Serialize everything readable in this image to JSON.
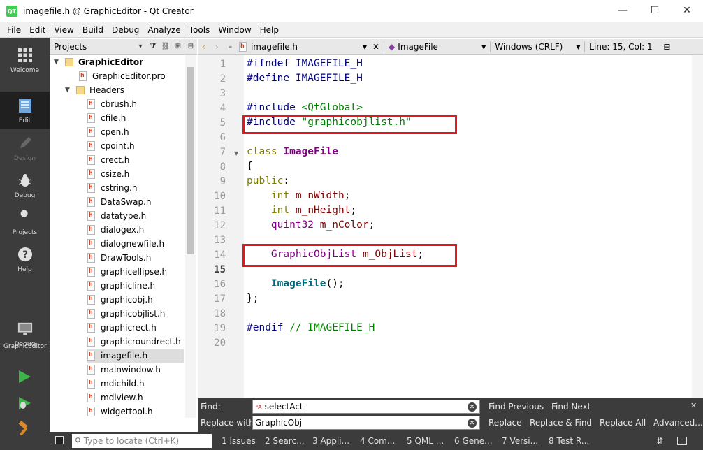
{
  "window": {
    "title": "imagefile.h @ GraphicEditor - Qt Creator",
    "logo_text": "QT",
    "minimize": "—",
    "maximize": "☐",
    "close": "✕"
  },
  "menu": [
    {
      "underline": "F",
      "rest": "ile"
    },
    {
      "underline": "E",
      "rest": "dit"
    },
    {
      "underline": "V",
      "rest": "iew"
    },
    {
      "underline": "B",
      "rest": "uild"
    },
    {
      "underline": "D",
      "rest": "ebug"
    },
    {
      "underline": "A",
      "rest": "nalyze"
    },
    {
      "underline": "T",
      "rest": "ools"
    },
    {
      "underline": "W",
      "rest": "indow"
    },
    {
      "underline": "H",
      "rest": "elp"
    }
  ],
  "modes": {
    "welcome": "Welcome",
    "edit": "Edit",
    "design": "Design",
    "debug": "Debug",
    "projects": "Projects",
    "help": "Help"
  },
  "kit": {
    "project": "GraphicEditor",
    "build": "Debug"
  },
  "project_panel": {
    "title": "Projects",
    "root": "GraphicEditor",
    "pro_file": "GraphicEditor.pro",
    "headers_label": "Headers",
    "files": [
      "cbrush.h",
      "cfile.h",
      "cpen.h",
      "cpoint.h",
      "crect.h",
      "csize.h",
      "cstring.h",
      "DataSwap.h",
      "datatype.h",
      "dialogex.h",
      "dialognewfile.h",
      "DrawTools.h",
      "graphicellipse.h",
      "graphicline.h",
      "graphicobj.h",
      "graphicobjlist.h",
      "graphicrect.h",
      "graphicroundrect.h",
      "imagefile.h",
      "mainwindow.h",
      "mdichild.h",
      "mdiview.h",
      "widgettool.h"
    ],
    "selected_file": "imagefile.h"
  },
  "editor_toolbar": {
    "file": "imagefile.h",
    "symbol": "ImageFile",
    "line_endings": "Windows (CRLF)",
    "position": "Line: 15, Col: 1"
  },
  "editor": {
    "current_line": 15,
    "line_numbers": [
      "1",
      "2",
      "3",
      "4",
      "5",
      "6",
      "7",
      "8",
      "9",
      "10",
      "11",
      "12",
      "13",
      "14",
      "15",
      "16",
      "17",
      "18",
      "19",
      "20"
    ],
    "lines": [
      [
        {
          "t": "#ifndef IMAGEFILE_H",
          "c": "c-pre"
        }
      ],
      [
        {
          "t": "#define IMAGEFILE_H",
          "c": "c-pre"
        }
      ],
      [],
      [
        {
          "t": "#include ",
          "c": "c-pre"
        },
        {
          "t": "<QtGlobal>",
          "c": "c-str"
        }
      ],
      [
        {
          "t": "#include ",
          "c": "c-pre"
        },
        {
          "t": "\"graphicobjlist.h\"",
          "c": "c-str"
        }
      ],
      [],
      [
        {
          "t": "class ",
          "c": "c-kw"
        },
        {
          "t": "ImageFile",
          "c": "c-cls"
        }
      ],
      [
        {
          "t": "{",
          "c": "c-plain"
        }
      ],
      [
        {
          "t": "public",
          "c": "c-kw"
        },
        {
          "t": ":",
          "c": "c-plain"
        }
      ],
      [
        {
          "t": "    ",
          "c": "c-plain"
        },
        {
          "t": "int",
          "c": "c-kw"
        },
        {
          "t": " ",
          "c": "c-plain"
        },
        {
          "t": "m_nWidth",
          "c": "c-mem"
        },
        {
          "t": ";",
          "c": "c-plain"
        }
      ],
      [
        {
          "t": "    ",
          "c": "c-plain"
        },
        {
          "t": "int",
          "c": "c-kw"
        },
        {
          "t": " ",
          "c": "c-plain"
        },
        {
          "t": "m_nHeight",
          "c": "c-mem"
        },
        {
          "t": ";",
          "c": "c-plain"
        }
      ],
      [
        {
          "t": "    ",
          "c": "c-plain"
        },
        {
          "t": "quint32",
          "c": "c-type"
        },
        {
          "t": " ",
          "c": "c-plain"
        },
        {
          "t": "m_nColor",
          "c": "c-mem"
        },
        {
          "t": ";",
          "c": "c-plain"
        }
      ],
      [],
      [
        {
          "t": "    ",
          "c": "c-plain"
        },
        {
          "t": "GraphicObjList",
          "c": "c-type"
        },
        {
          "t": " ",
          "c": "c-plain"
        },
        {
          "t": "m_ObjList",
          "c": "c-mem"
        },
        {
          "t": ";",
          "c": "c-plain"
        }
      ],
      [],
      [
        {
          "t": "    ",
          "c": "c-plain"
        },
        {
          "t": "ImageFile",
          "c": "c-fn"
        },
        {
          "t": "();",
          "c": "c-plain"
        }
      ],
      [
        {
          "t": "};",
          "c": "c-plain"
        }
      ],
      [],
      [
        {
          "t": "#endif ",
          "c": "c-pre"
        },
        {
          "t": "// IMAGEFILE_H",
          "c": "c-cmt"
        }
      ],
      []
    ]
  },
  "find": {
    "find_label": "Find:",
    "replace_label": "Replace with:",
    "find_value": "selectAct",
    "replace_value": "GraphicObj",
    "find_previous": "Find Previous",
    "find_next": "Find Next",
    "replace": "Replace",
    "replace_find": "Replace & Find",
    "replace_all": "Replace All",
    "advanced": "Advanced..."
  },
  "status": {
    "locator_placeholder": "Type to locate (Ctrl+K)",
    "tabs": [
      "1  Issues",
      "2  Searc...",
      "3  Appli...",
      "4  Com...",
      "5  QML ...",
      "6  Gene...",
      "7  Versi...",
      "8  Test R..."
    ]
  },
  "colors": {
    "highlight_box": "#e8141e",
    "mode_bar": "#3c3c3c",
    "run_green": "#3eb549"
  }
}
